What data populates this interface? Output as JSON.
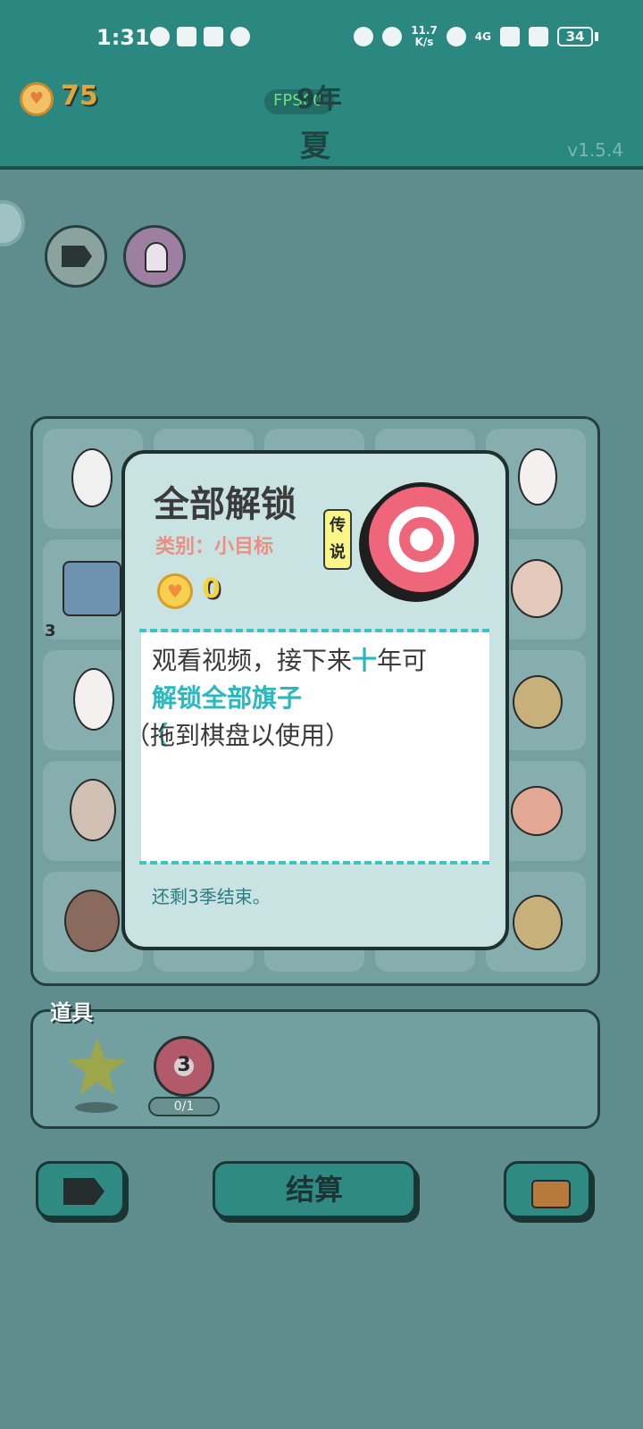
{
  "status_bar": {
    "time": "1:31",
    "net_speed_top": "11.7",
    "net_speed_bottom": "K/s",
    "network": "4G",
    "battery": "34",
    "left_icons": [
      "wechat-icon",
      "weibo-icon",
      "alipay-icon",
      "shield-icon"
    ],
    "right_icons": [
      "eye-icon",
      "alarm-icon",
      "wifi-icon",
      "signal-icon",
      "signal-x-icon"
    ]
  },
  "header": {
    "coins": "75",
    "fps": "FPS60",
    "year": "9年",
    "season": "夏",
    "version": "v1.5.4"
  },
  "props": {
    "label": "道具",
    "target_count": "3",
    "usage": "0/1"
  },
  "buttons": {
    "settle": "结算"
  },
  "board": {
    "cell_badge_count": "3"
  },
  "card": {
    "title": "全部解锁",
    "category": "类别：小目标",
    "rarity": "传说",
    "cost": "0",
    "desc_line1_a": "观看视频，接下来",
    "desc_line1_b": "十",
    "desc_line1_c": "年可",
    "desc_line2": "解锁全部旗子",
    "desc_line3": "（拖到棋盘以使用）",
    "hint": "还剩3季结束。"
  },
  "colors": {
    "header_bg": "#2b8880",
    "card_bg": "#c9e3e3",
    "accent": "#2ab8bf",
    "category": "#ec8f82",
    "target_red": "#ef6579"
  }
}
